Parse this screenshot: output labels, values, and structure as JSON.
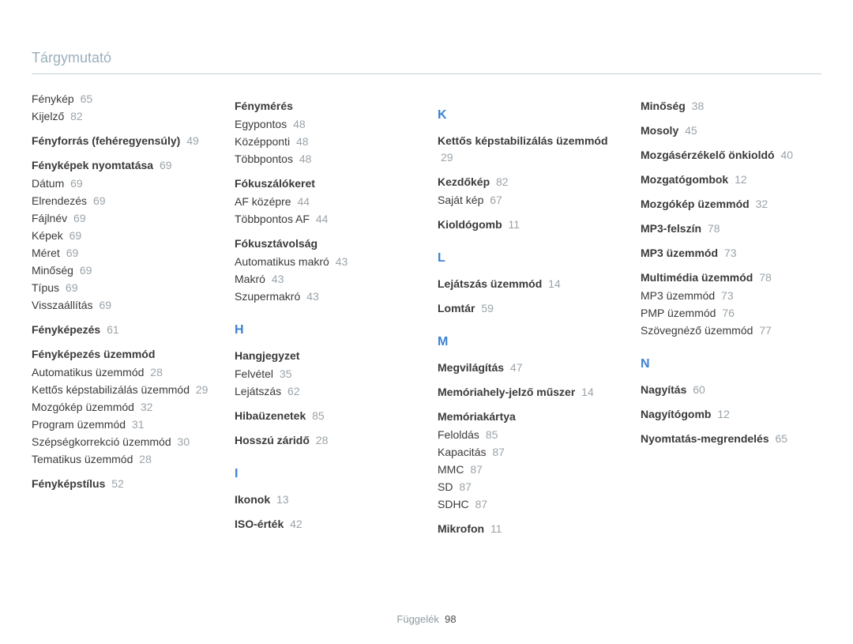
{
  "header": {
    "title": "Tárgymutató"
  },
  "footer": {
    "section": "Függelék",
    "page": "98"
  },
  "columns": [
    [
      {
        "type": "item",
        "label": "Fénykép",
        "page": "65"
      },
      {
        "type": "item",
        "label": "Kijelző",
        "page": "82"
      },
      {
        "type": "group",
        "label": "Fényforrás (fehéregyensúly)",
        "page": "49"
      },
      {
        "type": "group",
        "label": "Fényképek nyomtatása",
        "page": "69"
      },
      {
        "type": "item",
        "label": "Dátum",
        "page": "69"
      },
      {
        "type": "item",
        "label": "Elrendezés",
        "page": "69"
      },
      {
        "type": "item",
        "label": "Fájlnév",
        "page": "69"
      },
      {
        "type": "item",
        "label": "Képek",
        "page": "69"
      },
      {
        "type": "item",
        "label": "Méret",
        "page": "69"
      },
      {
        "type": "item",
        "label": "Minőség",
        "page": "69"
      },
      {
        "type": "item",
        "label": "Típus",
        "page": "69"
      },
      {
        "type": "item",
        "label": "Visszaállítás",
        "page": "69"
      },
      {
        "type": "group",
        "label": "Fényképezés",
        "page": "61"
      },
      {
        "type": "group",
        "label": "Fényképezés üzemmód"
      },
      {
        "type": "item",
        "label": "Automatikus üzemmód",
        "page": "28"
      },
      {
        "type": "item",
        "label": "Kettős képstabilizálás üzemmód",
        "page": "29"
      },
      {
        "type": "item",
        "label": "Mozgókép üzemmód",
        "page": "32"
      },
      {
        "type": "item",
        "label": "Program üzemmód",
        "page": "31"
      },
      {
        "type": "item",
        "label": "Szépségkorrekció üzemmód",
        "page": "30"
      },
      {
        "type": "item",
        "label": "Tematikus üzemmód",
        "page": "28"
      },
      {
        "type": "group",
        "label": "Fényképstílus",
        "page": "52"
      }
    ],
    [
      {
        "type": "group",
        "label": "Fénymérés"
      },
      {
        "type": "item",
        "label": "Egypontos",
        "page": "48"
      },
      {
        "type": "item",
        "label": "Középponti",
        "page": "48"
      },
      {
        "type": "item",
        "label": "Többpontos",
        "page": "48"
      },
      {
        "type": "group",
        "label": "Fókuszálókeret"
      },
      {
        "type": "item",
        "label": "AF középre",
        "page": "44"
      },
      {
        "type": "item",
        "label": "Többpontos AF",
        "page": "44"
      },
      {
        "type": "group",
        "label": "Fókusztávolság"
      },
      {
        "type": "item",
        "label": "Automatikus makró",
        "page": "43"
      },
      {
        "type": "item",
        "label": "Makró",
        "page": "43"
      },
      {
        "type": "item",
        "label": "Szupermakró",
        "page": "43"
      },
      {
        "type": "letter",
        "label": "H"
      },
      {
        "type": "group",
        "label": "Hangjegyzet"
      },
      {
        "type": "item",
        "label": "Felvétel",
        "page": "35"
      },
      {
        "type": "item",
        "label": "Lejátszás",
        "page": "62"
      },
      {
        "type": "group",
        "label": "Hibaüzenetek",
        "page": "85"
      },
      {
        "type": "group",
        "label": "Hosszú záridő",
        "page": "28"
      },
      {
        "type": "letter",
        "label": "I"
      },
      {
        "type": "group",
        "label": "Ikonok",
        "page": "13"
      },
      {
        "type": "group",
        "label": "ISO-érték",
        "page": "42"
      }
    ],
    [
      {
        "type": "letter",
        "label": "K"
      },
      {
        "type": "group",
        "label": "Kettős képstabilizálás üzemmód",
        "page": "29"
      },
      {
        "type": "group",
        "label": "Kezdőkép",
        "page": "82"
      },
      {
        "type": "item",
        "label": "Saját kép",
        "page": "67"
      },
      {
        "type": "group",
        "label": "Kioldógomb",
        "page": "11"
      },
      {
        "type": "letter",
        "label": "L"
      },
      {
        "type": "group",
        "label": "Lejátszás üzemmód",
        "page": "14"
      },
      {
        "type": "group",
        "label": "Lomtár",
        "page": "59"
      },
      {
        "type": "letter",
        "label": "M"
      },
      {
        "type": "group",
        "label": "Megvilágítás",
        "page": "47"
      },
      {
        "type": "group",
        "label": "Memóriahely-jelző műszer",
        "page": "14"
      },
      {
        "type": "group",
        "label": "Memóriakártya"
      },
      {
        "type": "item",
        "label": "Feloldás",
        "page": "85"
      },
      {
        "type": "item",
        "label": "Kapacitás",
        "page": "87"
      },
      {
        "type": "item",
        "label": "MMC",
        "page": "87"
      },
      {
        "type": "item",
        "label": "SD",
        "page": "87"
      },
      {
        "type": "item",
        "label": "SDHC",
        "page": "87"
      },
      {
        "type": "group",
        "label": "Mikrofon",
        "page": "11"
      }
    ],
    [
      {
        "type": "group",
        "label": "Minőség",
        "page": "38"
      },
      {
        "type": "group",
        "label": "Mosoly",
        "page": "45"
      },
      {
        "type": "group",
        "label": "Mozgásérzékelő önkioldó",
        "page": "40"
      },
      {
        "type": "group",
        "label": "Mozgatógombok",
        "page": "12"
      },
      {
        "type": "group",
        "label": "Mozgókép üzemmód",
        "page": "32"
      },
      {
        "type": "group",
        "label": "MP3-felszín",
        "page": "78"
      },
      {
        "type": "group",
        "label": "MP3 üzemmód",
        "page": "73"
      },
      {
        "type": "group",
        "label": "Multimédia üzemmód",
        "page": "78"
      },
      {
        "type": "item",
        "label": "MP3 üzemmód",
        "page": "73"
      },
      {
        "type": "item",
        "label": "PMP üzemmód",
        "page": "76"
      },
      {
        "type": "item",
        "label": "Szövegnéző üzemmód",
        "page": "77"
      },
      {
        "type": "letter",
        "label": "N"
      },
      {
        "type": "group",
        "label": "Nagyítás",
        "page": "60"
      },
      {
        "type": "group",
        "label": "Nagyítógomb",
        "page": "12"
      },
      {
        "type": "group",
        "label": "Nyomtatás-megrendelés",
        "page": "65"
      }
    ]
  ]
}
